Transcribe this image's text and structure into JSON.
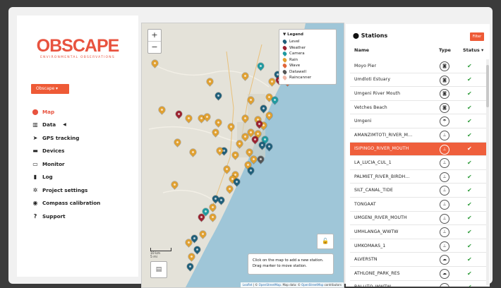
{
  "logo": {
    "main": "OBSCAPE",
    "sub": "ENVIRONMENTAL OBSERVATIONS"
  },
  "org_selector": {
    "label": "Obscape ▾"
  },
  "nav": [
    {
      "label": "Map",
      "icon": "map-pin-icon",
      "active": true
    },
    {
      "label": "Data",
      "icon": "chart-icon",
      "has_arrow": true
    },
    {
      "label": "GPS tracking",
      "icon": "location-arrow-icon"
    },
    {
      "label": "Devices",
      "icon": "devices-icon"
    },
    {
      "label": "Monitor",
      "icon": "monitor-icon"
    },
    {
      "label": "Log",
      "icon": "book-icon"
    },
    {
      "label": "Project settings",
      "icon": "gears-icon"
    },
    {
      "label": "Compass calibration",
      "icon": "compass-icon"
    },
    {
      "label": "Support",
      "icon": "question-icon"
    }
  ],
  "map": {
    "zoom_in": "+",
    "zoom_out": "−",
    "legend": {
      "title": "▼ Legend",
      "items": [
        {
          "label": "Level",
          "color": "#1f5f7a"
        },
        {
          "label": "Weather",
          "color": "#9b2230"
        },
        {
          "label": "Camera",
          "color": "#1f9aa0"
        },
        {
          "label": "Rain",
          "color": "#e0a030"
        },
        {
          "label": "Wave",
          "color": "#e0663a"
        },
        {
          "label": "Datawell",
          "color": "#555555"
        },
        {
          "label": "Raincanner",
          "color": "#f2b8a8"
        }
      ]
    },
    "info": {
      "line1": "Click on the map to add a new station.",
      "line2": "Drag marker to move station."
    },
    "scale": {
      "km": "10 km",
      "mi": "5 mi"
    },
    "attribution": {
      "leaflet": "Leaflet",
      "sep1": " | © ",
      "osm": "OpenStreetMap",
      "rest": ". Map data: © ",
      "osm2": "OpenStreetMap",
      "end": " contributors"
    },
    "lock_label": "🔓"
  },
  "stations": {
    "title": "Stations",
    "filter_label": "Filter",
    "col_name": "Name",
    "col_type": "Type",
    "col_status": "Status ▾",
    "rows": [
      {
        "name": "Moyo Pier",
        "type": "cam"
      },
      {
        "name": "Umdloti Estuary",
        "type": "cam"
      },
      {
        "name": "Umgeni River Mouth",
        "type": "cam"
      },
      {
        "name": "Vetches Beach",
        "type": "cam"
      },
      {
        "name": "Umgeni",
        "type": "rain"
      },
      {
        "name": "AMANZIMTOTI_RIVER_M...",
        "type": "lvl"
      },
      {
        "name": "ISIPINGO_RIVER_MOUTH",
        "type": "lvl",
        "selected": true
      },
      {
        "name": "LA_LUCIA_CUL_1",
        "type": "lvl"
      },
      {
        "name": "PALMIET_RIVER_BIRDH...",
        "type": "lvl"
      },
      {
        "name": "SILT_CANAL_TIDE",
        "type": "lvl"
      },
      {
        "name": "TONGAAT",
        "type": "lvl"
      },
      {
        "name": "UMGENI_RIVER_MOUTH",
        "type": "lvl"
      },
      {
        "name": "UMHLANGA_WWTW",
        "type": "lvl"
      },
      {
        "name": "UMKOMAAS_1",
        "type": "lvl"
      },
      {
        "name": "ALVERSTN",
        "type": "wx"
      },
      {
        "name": "ATHLONE_PARK_RES",
        "type": "wx"
      },
      {
        "name": "BALLITO_WWTW",
        "type": "wx"
      }
    ],
    "status_glyph": "✔"
  }
}
